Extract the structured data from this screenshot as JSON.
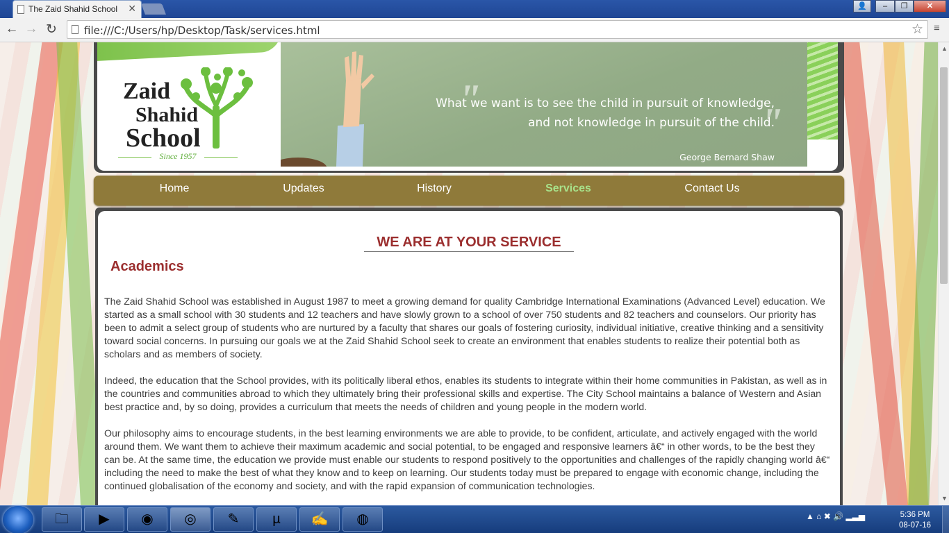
{
  "browser": {
    "tab_title": "The Zaid Shahid School",
    "tab_close": "✕",
    "url": "file:///C:/Users/hp/Desktop/Task/services.html",
    "back_icon": "←",
    "forward_icon": "→",
    "reload_icon": "↻",
    "star_icon": "☆",
    "menu_icon": "≡",
    "window_buttons": {
      "user": "👤",
      "minimize": "–",
      "maximize": "❐",
      "close": "✕"
    }
  },
  "header": {
    "logo_line1": "Zaid",
    "logo_line2": "Shahid",
    "logo_line3": "School",
    "since": "Since 1957",
    "quote_line1": "What we want is to see the child in pursuit of knowledge,",
    "quote_line2": "and not knowledge in pursuit of the child.",
    "quote_author": "George Bernard Shaw",
    "accent_color": "#7ec24c"
  },
  "nav": {
    "items": [
      {
        "label": "Home"
      },
      {
        "label": "Updates"
      },
      {
        "label": "History"
      },
      {
        "label": "Services",
        "active": true
      },
      {
        "label": "Contact Us"
      }
    ],
    "bg_color": "#8f7a3a",
    "active_color": "#a8e28a"
  },
  "main": {
    "heading": "WE ARE AT YOUR SERVICE",
    "section_title": "Academics",
    "paragraphs": [
      "The Zaid Shahid School was established in August 1987 to meet a growing demand for quality Cambridge International Examinations (Advanced Level) education. We started as a small school with 30 students and 12 teachers and have slowly grown to a school of over 750 students and 82 teachers and counselors. Our priority has been to admit a select group of students who are nurtured by a faculty that shares our goals of fostering curiosity, individual initiative, creative thinking and a sensitivity toward social concerns. In pursuing our goals we at the Zaid Shahid School seek to create an environment that enables students to realize their potential both as scholars and as members of society.",
      "Indeed, the education that the School provides, with its politically liberal ethos, enables its students to integrate within their home communities in Pakistan, as well as in the countries and communities abroad to which they ultimately bring their professional skills and expertise. The City School maintains a balance of Western and Asian best practice and, by so doing, provides a curriculum that meets the needs of children and young people in the modern world.",
      "Our philosophy aims to encourage students, in the best learning environments we are able to provide, to be confident, articulate, and actively engaged with the world around them. We want them to achieve their maximum academic and social potential, to be engaged and responsive learners â€“ in other words, to be the best they can be. At the same time, the education we provide must enable our students to respond positively to the opportunities and challenges of the rapidly changing world â€“ including the need to make the best of what they know and to keep on learning. Our students today must be prepared to engage with economic change, including the continued globalisation of the economy and society, and with the rapid expansion of communication technologies."
    ],
    "heading_color": "#9b2e2e"
  },
  "taskbar": {
    "apps": [
      {
        "icon": "folder-icon",
        "glyph": "🗀"
      },
      {
        "icon": "media-player-icon",
        "glyph": "▶"
      },
      {
        "icon": "firefox-icon",
        "glyph": "◉"
      },
      {
        "icon": "chrome-icon",
        "glyph": "◎"
      },
      {
        "icon": "notepad-icon",
        "glyph": "✎"
      },
      {
        "icon": "utorrent-icon",
        "glyph": "µ"
      },
      {
        "icon": "notepadpp-icon",
        "glyph": "✍"
      },
      {
        "icon": "media-app-icon",
        "glyph": "◍"
      }
    ],
    "tray": "▲  ⌂  ✖  🔊  ▂▃▅",
    "time": "5:36 PM",
    "date": "08-07-16"
  }
}
